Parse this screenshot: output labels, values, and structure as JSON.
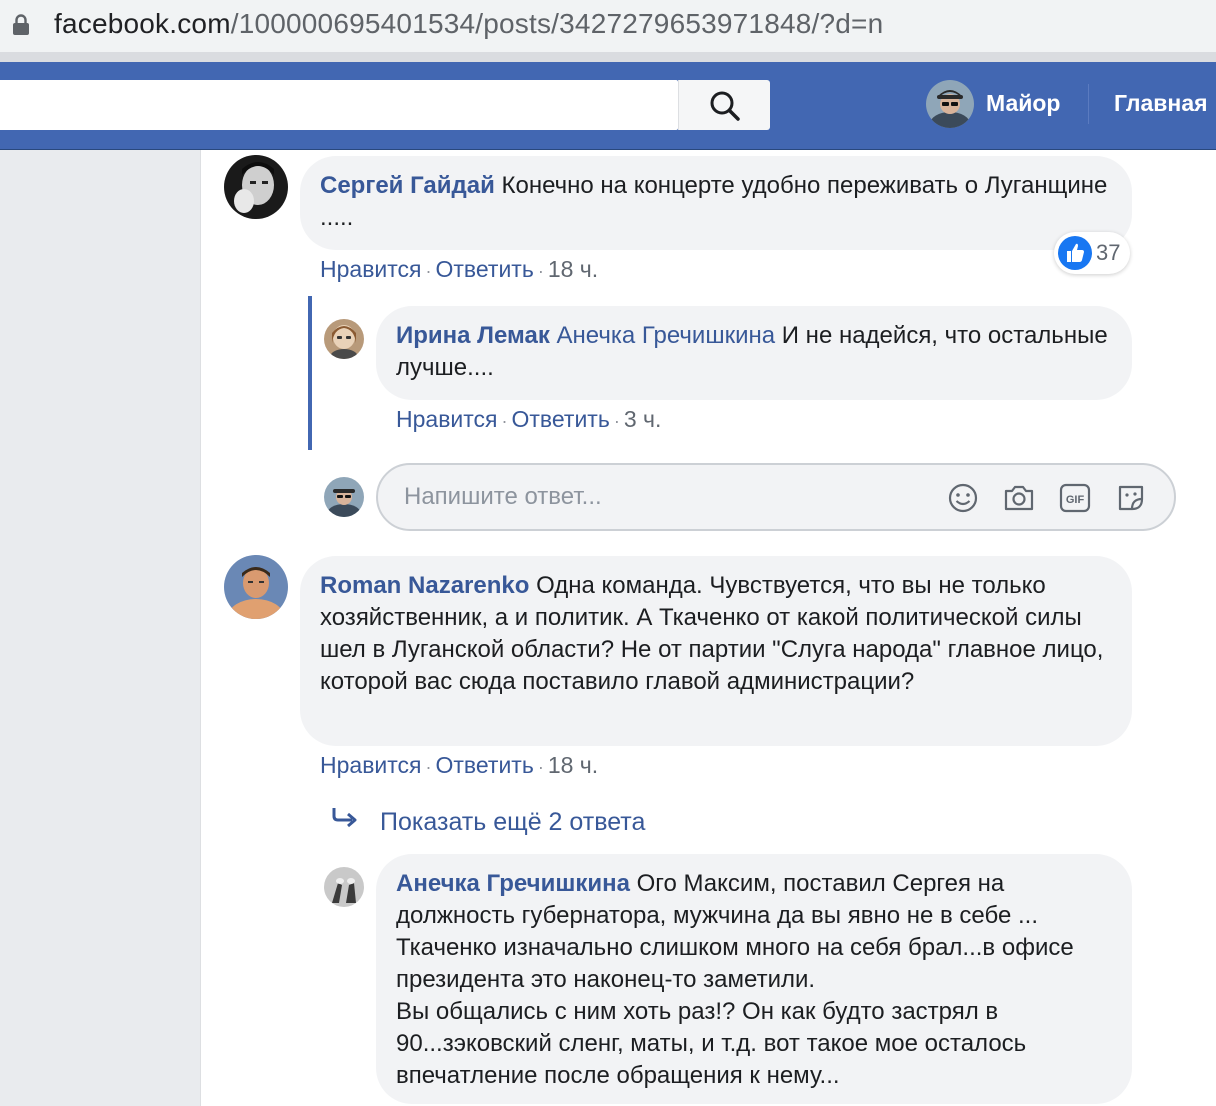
{
  "browser": {
    "url_domain": "facebook.com",
    "url_path": "/100000695401534/posts/3427279653971848/?d=n"
  },
  "header": {
    "search_placeholder": "",
    "user_name": "Майор",
    "home_label": "Главная"
  },
  "comments": [
    {
      "author": "Сергей Гайдай",
      "text": "Конечно на концерте удобно переживать о Луганщине .....",
      "like_label": "Нравится",
      "reply_label": "Ответить",
      "time": "18 ч.",
      "reaction_count": "37",
      "replies": [
        {
          "author": "Ирина Лемак",
          "mention": "Анечка Гречишкина",
          "text": "И не надейся, что остальные лучше....",
          "like_label": "Нравится",
          "reply_label": "Ответить",
          "time": "3 ч."
        }
      ],
      "reply_input_placeholder": "Напишите ответ..."
    },
    {
      "author": "Roman Nazarenko",
      "text": "Одна команда. Чувствуется, что вы не только хозяйственник, а и политик. А Ткаченко от какой политической силы шел в Луганской области? Не от партии \"Слуга народа\" главное лицо, которой вас сюда поставило главой администрации?",
      "like_label": "Нравится",
      "reply_label": "Ответить",
      "time": "18 ч.",
      "show_more_label": "Показать ещё 2 ответа",
      "replies": [
        {
          "author": "Анечка Гречишкина",
          "text_line1": "Ого Максим, поставил Сергея на должность губернатора, мужчина да вы явно не в себе ... Ткаченко изначально слишком много на себя брал...в офисе президента это наконец-то заметили.",
          "text_line2": "Вы общались с ним хоть раз!? Он как будто застрял в 90...зэковский сленг, маты, и т.д. вот такое мое осталось впечатление после обращения к нему..."
        }
      ]
    }
  ],
  "colors": {
    "fb_blue": "#4267b2",
    "link_blue": "#385898",
    "bubble_gray": "#f2f3f5",
    "like_blue": "#1877f2"
  }
}
